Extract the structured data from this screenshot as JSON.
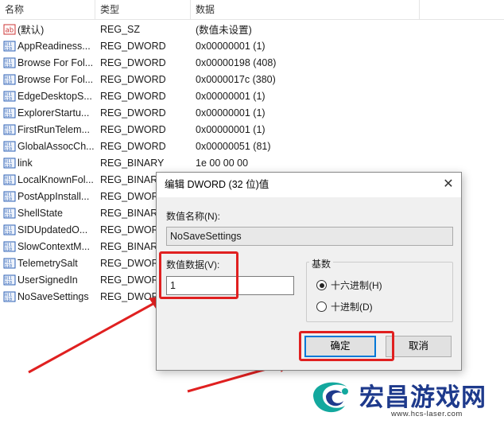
{
  "columns": {
    "name": "名称",
    "type": "类型",
    "data": "数据"
  },
  "rows": [
    {
      "icon": "string-value-icon",
      "name": "(默认)",
      "type": "REG_SZ",
      "data": "(数值未设置)"
    },
    {
      "icon": "binary-value-icon",
      "name": "AppReadiness...",
      "type": "REG_DWORD",
      "data": "0x00000001 (1)"
    },
    {
      "icon": "binary-value-icon",
      "name": "Browse For Fol...",
      "type": "REG_DWORD",
      "data": "0x00000198 (408)"
    },
    {
      "icon": "binary-value-icon",
      "name": "Browse For Fol...",
      "type": "REG_DWORD",
      "data": "0x0000017c (380)"
    },
    {
      "icon": "binary-value-icon",
      "name": "EdgeDesktopS...",
      "type": "REG_DWORD",
      "data": "0x00000001 (1)"
    },
    {
      "icon": "binary-value-icon",
      "name": "ExplorerStartu...",
      "type": "REG_DWORD",
      "data": "0x00000001 (1)"
    },
    {
      "icon": "binary-value-icon",
      "name": "FirstRunTelem...",
      "type": "REG_DWORD",
      "data": "0x00000001 (1)"
    },
    {
      "icon": "binary-value-icon",
      "name": "GlobalAssocCh...",
      "type": "REG_DWORD",
      "data": "0x00000051 (81)"
    },
    {
      "icon": "binary-value-icon",
      "name": "link",
      "type": "REG_BINARY",
      "data": "1e 00 00 00"
    },
    {
      "icon": "binary-value-icon",
      "name": "LocalKnownFol...",
      "type": "REG_BINARY",
      "data": ""
    },
    {
      "icon": "binary-value-icon",
      "name": "PostAppInstall...",
      "type": "REG_DWORD",
      "data": ""
    },
    {
      "icon": "binary-value-icon",
      "name": "ShellState",
      "type": "REG_BINARY",
      "data": ""
    },
    {
      "icon": "binary-value-icon",
      "name": "SIDUpdatedO...",
      "type": "REG_DWORD",
      "data": ""
    },
    {
      "icon": "binary-value-icon",
      "name": "SlowContextM...",
      "type": "REG_BINARY",
      "data": ""
    },
    {
      "icon": "binary-value-icon",
      "name": "TelemetrySalt",
      "type": "REG_DWORD",
      "data": ""
    },
    {
      "icon": "binary-value-icon",
      "name": "UserSignedIn",
      "type": "REG_DWORD",
      "data": ""
    },
    {
      "icon": "binary-value-icon",
      "name": "NoSaveSettings",
      "type": "REG_DWORD",
      "data": ""
    }
  ],
  "dialog": {
    "title": "编辑 DWORD (32 位)值",
    "close": "✕",
    "name_label": "数值名称(N):",
    "name_value": "NoSaveSettings",
    "data_label": "数值数据(V):",
    "data_value": "1",
    "base_label": "基数",
    "radio_hex": "十六进制(H)",
    "radio_dec": "十进制(D)",
    "selected_base": "hex",
    "ok": "确定",
    "cancel": "取消"
  },
  "watermark": {
    "brand": "宏昌游戏网",
    "url": "www.hcs-laser.com"
  },
  "colors": {
    "highlight": "#e02020",
    "accent": "#0078d7",
    "brand": "#1e3a8c"
  }
}
